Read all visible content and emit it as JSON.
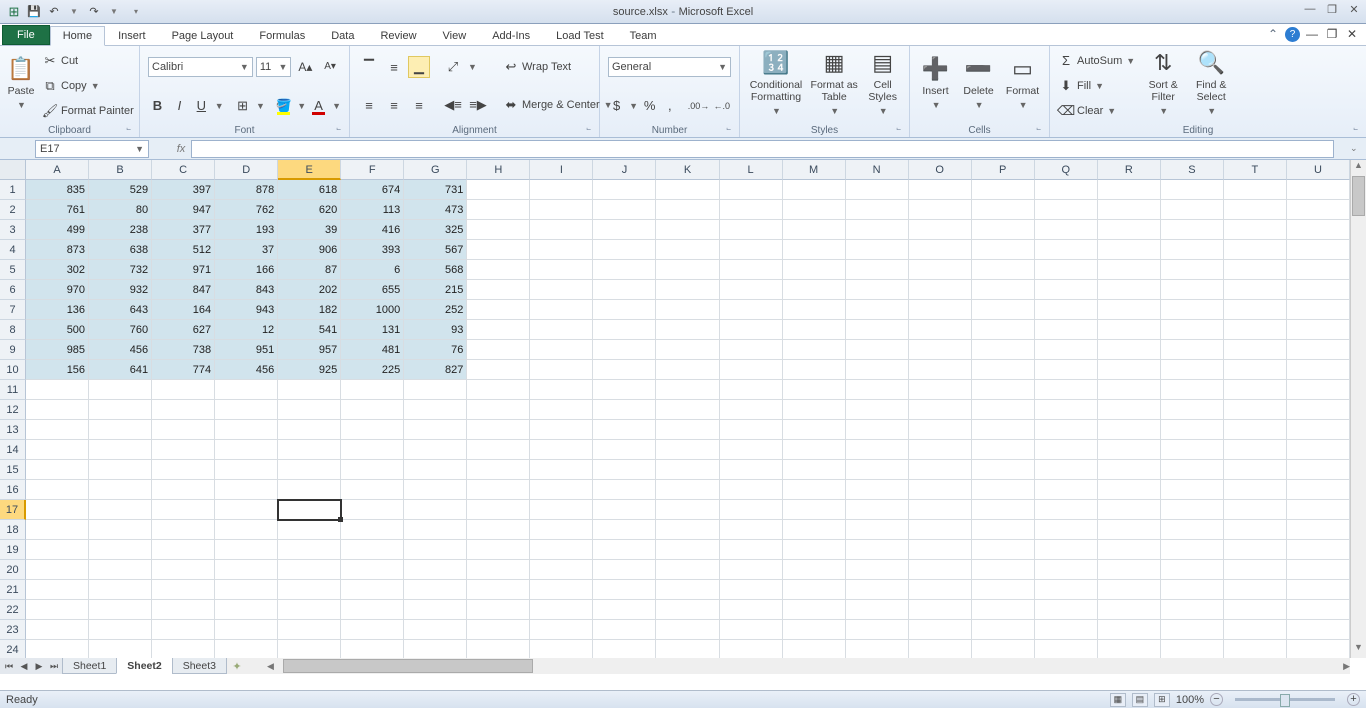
{
  "title_doc": "source.xlsx",
  "title_app": "Microsoft Excel",
  "qat": {
    "save": "💾",
    "undo": "↶",
    "redo": "↷"
  },
  "tabs": [
    "File",
    "Home",
    "Insert",
    "Page Layout",
    "Formulas",
    "Data",
    "Review",
    "View",
    "Add-Ins",
    "Load Test",
    "Team"
  ],
  "active_tab": "Home",
  "ribbon": {
    "clipboard": {
      "label": "Clipboard",
      "paste": "Paste",
      "cut": "Cut",
      "copy": "Copy",
      "fp": "Format Painter"
    },
    "font": {
      "label": "Font",
      "name": "Calibri",
      "size": "11"
    },
    "alignment": {
      "label": "Alignment",
      "wrap": "Wrap Text",
      "merge": "Merge & Center"
    },
    "number": {
      "label": "Number",
      "format": "General"
    },
    "styles": {
      "label": "Styles",
      "cf": "Conditional Formatting",
      "fat": "Format as Table",
      "cs": "Cell Styles"
    },
    "cells": {
      "label": "Cells",
      "ins": "Insert",
      "del": "Delete",
      "fmt": "Format"
    },
    "editing": {
      "label": "Editing",
      "as": "AutoSum",
      "fill": "Fill",
      "clr": "Clear",
      "sf": "Sort & Filter",
      "fs": "Find & Select"
    }
  },
  "namebox": "E17",
  "columns": [
    "A",
    "B",
    "C",
    "D",
    "E",
    "F",
    "G",
    "H",
    "I",
    "J",
    "K",
    "L",
    "M",
    "N",
    "O",
    "P",
    "Q",
    "R",
    "S",
    "T",
    "U"
  ],
  "selected_col": "E",
  "selected_row": 17,
  "data_rows": [
    [
      835,
      529,
      397,
      878,
      618,
      674,
      731
    ],
    [
      761,
      80,
      947,
      762,
      620,
      113,
      473
    ],
    [
      499,
      238,
      377,
      193,
      39,
      416,
      325
    ],
    [
      873,
      638,
      512,
      37,
      906,
      393,
      567
    ],
    [
      302,
      732,
      971,
      166,
      87,
      6,
      568
    ],
    [
      970,
      932,
      847,
      843,
      202,
      655,
      215
    ],
    [
      136,
      643,
      164,
      943,
      182,
      1000,
      252
    ],
    [
      500,
      760,
      627,
      12,
      541,
      131,
      93
    ],
    [
      985,
      456,
      738,
      951,
      957,
      481,
      76
    ],
    [
      156,
      641,
      774,
      456,
      925,
      225,
      827
    ]
  ],
  "total_rows": 24,
  "sheets": [
    "Sheet1",
    "Sheet2",
    "Sheet3"
  ],
  "active_sheet": "Sheet2",
  "status": "Ready",
  "zoom": "100%"
}
